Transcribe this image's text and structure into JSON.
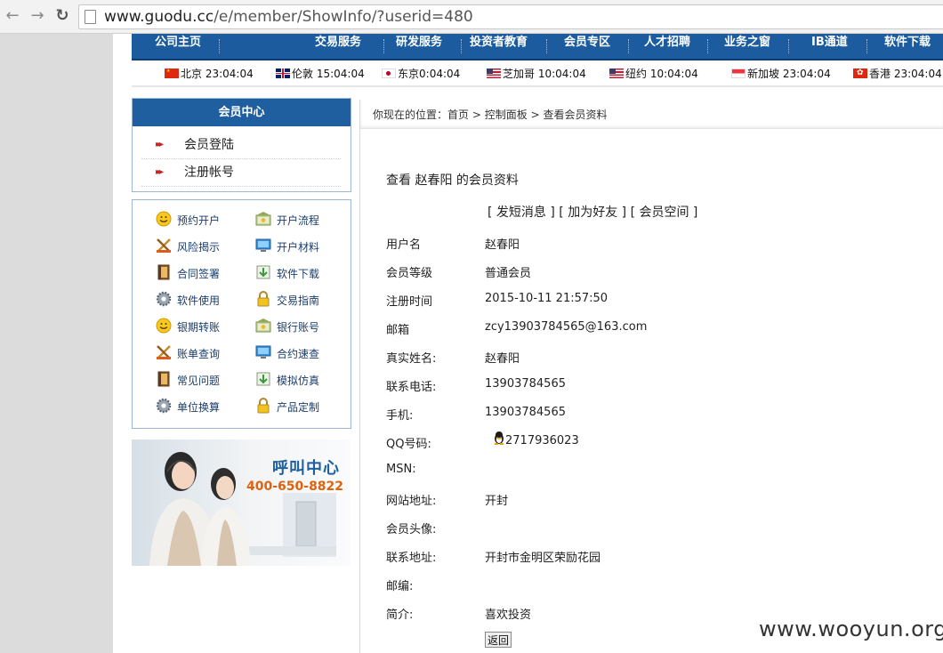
{
  "browser": {
    "url_host": "www.guodu.cc",
    "url_path": "/e/member/ShowInfo/?userid=480"
  },
  "nav": {
    "items": [
      "公司主页",
      "交易服务",
      "研发服务",
      "投资者教育",
      "会员专区",
      "人才招聘",
      "业务之窗",
      "IB通道",
      "软件下载"
    ]
  },
  "clocks": [
    {
      "city": "北京",
      "time": "23:04:04",
      "flag": "cn-flag-icon"
    },
    {
      "city": "伦敦",
      "time": "15:04:04",
      "flag": "uk-flag-icon"
    },
    {
      "city": "东京",
      "time": "0:04:04",
      "flag": "jp-flag-icon"
    },
    {
      "city": "芝加哥",
      "time": "10:04:04",
      "flag": "us-flag-icon"
    },
    {
      "city": "纽约",
      "time": "10:04:04",
      "flag": "us-flag-icon"
    },
    {
      "city": "新加坡",
      "time": "23:04:04",
      "flag": "sg-flag-icon"
    },
    {
      "city": "香港",
      "time": "23:04:04",
      "flag": "hk-flag-icon"
    }
  ],
  "member_center": {
    "title": "会员中心",
    "items": [
      "会员登陆",
      "注册帐号"
    ]
  },
  "quick_links": [
    {
      "label": "预约开户",
      "icon": "smiley-icon"
    },
    {
      "label": "开户流程",
      "icon": "bank-icon"
    },
    {
      "label": "风险揭示",
      "icon": "warning-tools-icon"
    },
    {
      "label": "开户材料",
      "icon": "monitor-icon"
    },
    {
      "label": "合同签署",
      "icon": "book-icon"
    },
    {
      "label": "软件下载",
      "icon": "download-icon"
    },
    {
      "label": "软件使用",
      "icon": "gear-icon"
    },
    {
      "label": "交易指南",
      "icon": "lock-icon"
    },
    {
      "label": "银期转账",
      "icon": "smiley-icon"
    },
    {
      "label": "银行账号",
      "icon": "bank-icon"
    },
    {
      "label": "账单查询",
      "icon": "warning-tools-icon"
    },
    {
      "label": "合约速查",
      "icon": "monitor-icon"
    },
    {
      "label": "常见问题",
      "icon": "book-icon"
    },
    {
      "label": "模拟仿真",
      "icon": "download-icon"
    },
    {
      "label": "单位换算",
      "icon": "gear-icon"
    },
    {
      "label": "产品定制",
      "icon": "lock-icon"
    }
  ],
  "banner": {
    "title": "呼叫中心",
    "phone": "400-650-8822"
  },
  "breadcrumb": {
    "prefix": "你现在的位置：",
    "items": [
      "首页",
      "控制面板",
      "查看会员资料"
    ],
    "separator": ">"
  },
  "profile": {
    "heading": "查看 赵春阳 的会员资料",
    "actions": [
      "[ 发短消息 ]",
      "[ 加为好友 ]",
      "[ 会员空间 ]"
    ],
    "fields": [
      {
        "label": "用户名",
        "value": "赵春阳"
      },
      {
        "label": "会员等级",
        "value": "普通会员"
      },
      {
        "label": "注册时间",
        "value": "2015-10-11 21:57:50"
      },
      {
        "label": "邮箱",
        "value": "zcy13903784565@163.com"
      },
      {
        "label": "真实姓名:",
        "value": "赵春阳"
      },
      {
        "label": "联系电话:",
        "value": "13903784565"
      },
      {
        "label": "手机:",
        "value": "13903784565"
      },
      {
        "label": "QQ号码:",
        "value": "2717936023"
      },
      {
        "label": "MSN:",
        "value": ""
      },
      {
        "label": "网站地址:",
        "value": "开封"
      },
      {
        "label": "会员头像:",
        "value": ""
      },
      {
        "label": "联系地址:",
        "value": "开封市金明区荣励花园"
      },
      {
        "label": "邮编:",
        "value": ""
      },
      {
        "label": "简介:",
        "value": "喜欢投资"
      }
    ],
    "back_label": "返回"
  },
  "watermark": "www.wooyun.org",
  "colors": {
    "nav_blue": "#1c5c9e",
    "link_blue": "#1a3d6d",
    "phone_orange": "#e0620e"
  }
}
